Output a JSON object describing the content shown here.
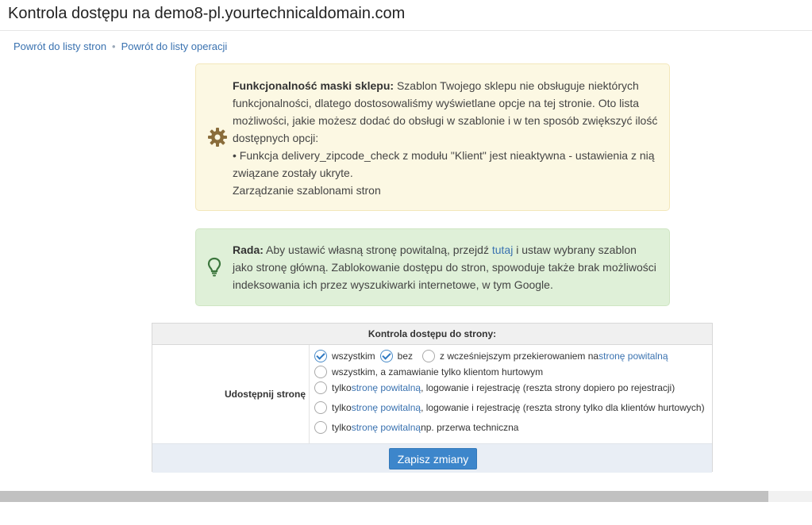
{
  "page": {
    "title": "Kontrola dostępu na demo8-pl.yourtechnicaldomain.com"
  },
  "breadcrumb": {
    "items": [
      "Powrót do listy stron",
      "Powrót do listy operacji"
    ],
    "separator": "•"
  },
  "warning": {
    "icon": "gear-icon",
    "bold": "Funkcjonalność maski sklepu:",
    "text": " Szablon Twojego sklepu nie obsługuje niektórych funkcjonalności, dlatego dostosowaliśmy wyświetlane opcje na tej stronie. Oto lista możliwości, jakie możesz dodać do obsługi w szablonie i w ten sposób zwiększyć ilość dostępnych opcji:",
    "item": "• Funkcja delivery_zipcode_check z modułu \"Klient\" jest nieaktywna - ustawienia z nią związane zostały ukryte.",
    "link": "Zarządzanie szablonami stron"
  },
  "tip": {
    "icon": "lightbulb-icon",
    "bold": "Rada:",
    "text_before": " Aby ustawić własną stronę powitalną, przejdź ",
    "link": "tutaj",
    "text_after": " i ustaw wybrany szablon jako stronę główną. Zablokowanie dostępu do stron, spowoduje także brak możliwości indeksowania ich przez wyszukiwarki internetowe, w tym Google."
  },
  "access_form": {
    "header": "Kontrola dostępu do strony:",
    "row_label": "Udostępnij stronę",
    "options": [
      {
        "label": "wszystkim",
        "checked": true
      },
      {
        "label": "bez",
        "checked": true
      },
      {
        "label_before": "z wcześniejszym przekierowaniem na ",
        "link": "stronę powitalną",
        "label_after": "",
        "checked": false
      },
      {
        "label": "wszystkim, a zamawianie tylko klientom hurtowym",
        "checked": false
      },
      {
        "label_before": "tylko ",
        "link": "stronę powitalną",
        "label_after": ", logowanie i rejestrację (reszta strony dopiero po rejestracji)",
        "checked": false
      },
      {
        "label_before": "tylko ",
        "link": "stronę powitalną",
        "label_after": ", logowanie i rejestrację (reszta strony tylko dla klientów hurtowych)",
        "checked": false
      },
      {
        "label_before": "tylko ",
        "link": "stronę powitalną",
        "label_after": " np. przerwa techniczna",
        "checked": false
      }
    ],
    "save_label": "Zapisz zmiany"
  },
  "colors": {
    "link": "#3a72b0",
    "button": "#3d86cb",
    "warning_bg": "#fcf8e3",
    "success_bg": "#dff0d8",
    "gear_icon": "#8a6d3b",
    "bulb_icon": "#3c763d"
  }
}
